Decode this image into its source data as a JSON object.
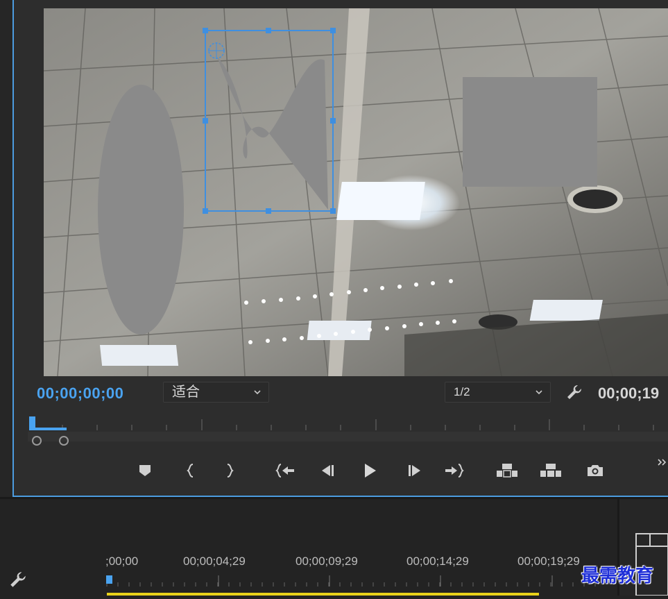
{
  "monitor": {
    "playhead_timecode": "00;00;00;00",
    "fit_select": {
      "value": "适合",
      "chevron": "chevron-down-icon"
    },
    "resolution_select": {
      "value": "1/2",
      "chevron": "chevron-down-icon"
    },
    "settings_icon": "wrench-icon",
    "duration_timecode": "00;00;19"
  },
  "transport": {
    "buttons": [
      {
        "name": "add-marker",
        "icon": "marker-icon"
      },
      {
        "name": "mark-in",
        "icon": "mark-in-icon"
      },
      {
        "name": "mark-out",
        "icon": "mark-out-icon"
      },
      {
        "name": "go-to-in",
        "icon": "go-to-in-icon"
      },
      {
        "name": "step-back",
        "icon": "step-back-icon"
      },
      {
        "name": "play",
        "icon": "play-icon"
      },
      {
        "name": "step-forward",
        "icon": "step-forward-icon"
      },
      {
        "name": "go-to-out",
        "icon": "go-to-out-icon"
      },
      {
        "name": "lift",
        "icon": "lift-icon"
      },
      {
        "name": "extract",
        "icon": "extract-icon"
      },
      {
        "name": "export-frame",
        "icon": "camera-icon"
      },
      {
        "name": "more",
        "icon": "double-chevron-right-icon"
      }
    ]
  },
  "timeline": {
    "settings_icon": "wrench-icon",
    "ruler_labels": [
      ";00;00",
      "00;00;04;29",
      "00;00;09;29",
      "00;00;14;29",
      "00;00;19;29"
    ],
    "work_area_color": "#e8d21a"
  },
  "watermark": "最需教育",
  "colors": {
    "accent": "#4aa3f0",
    "selection": "#3f8fe0",
    "shape_gray": "#8a8a8a"
  }
}
